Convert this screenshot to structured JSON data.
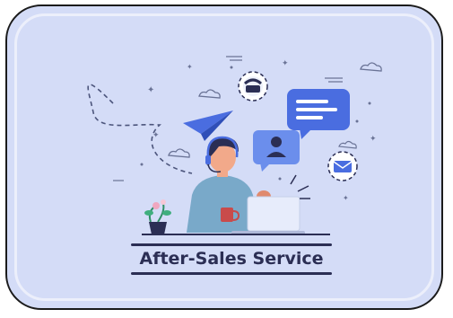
{
  "banner": {
    "title": "After-Sales Service"
  },
  "icons": [
    "telephone-icon",
    "chat-bubble-icon",
    "user-profile-icon",
    "email-icon",
    "paper-plane-icon",
    "cloud-icon",
    "sparkle-icon",
    "plant-icon",
    "laptop-icon",
    "coffee-cup-icon"
  ],
  "colors": {
    "background": "#d4dcf7",
    "accent_blue": "#4a6de0",
    "dark_navy": "#2b2e54",
    "sweater": "#79a9c9",
    "border": "#1b1b1b"
  }
}
